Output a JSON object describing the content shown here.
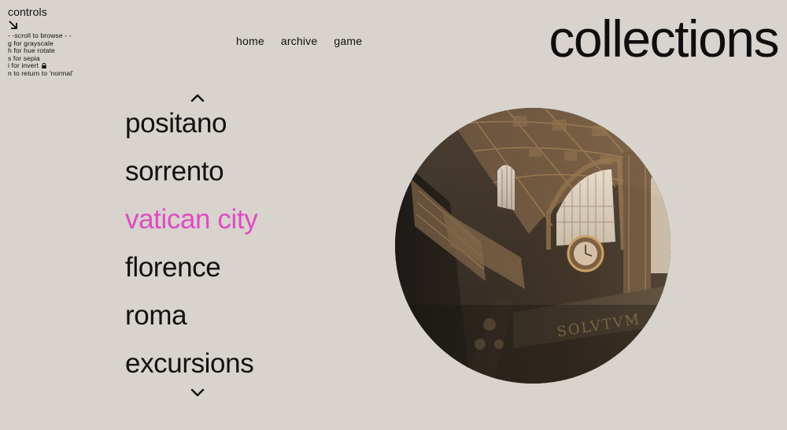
{
  "controls": {
    "title": "controls",
    "lines": [
      "- -scroll to browse - -",
      "g for grayscale",
      "h for hue rotate",
      "s for sepia",
      "i for invert",
      "n to return to 'normal'"
    ],
    "arrow_icon": "arrow-down-right-icon",
    "lock_icon": "lock-icon"
  },
  "nav": {
    "items": [
      "home",
      "archive",
      "game"
    ]
  },
  "page": {
    "title": "collections"
  },
  "menu": {
    "items": [
      "positano",
      "sorrento",
      "vatican city",
      "florence",
      "roma",
      "excursions"
    ],
    "active_index": 2,
    "active_color": "#e04bc6",
    "up_icon": "chevron-up-icon",
    "down_icon": "chevron-down-icon"
  },
  "image": {
    "inscription": "SOLVTVM"
  },
  "colors": {
    "background": "#d8d3cd",
    "text": "#111111",
    "accent": "#e04bc6"
  }
}
